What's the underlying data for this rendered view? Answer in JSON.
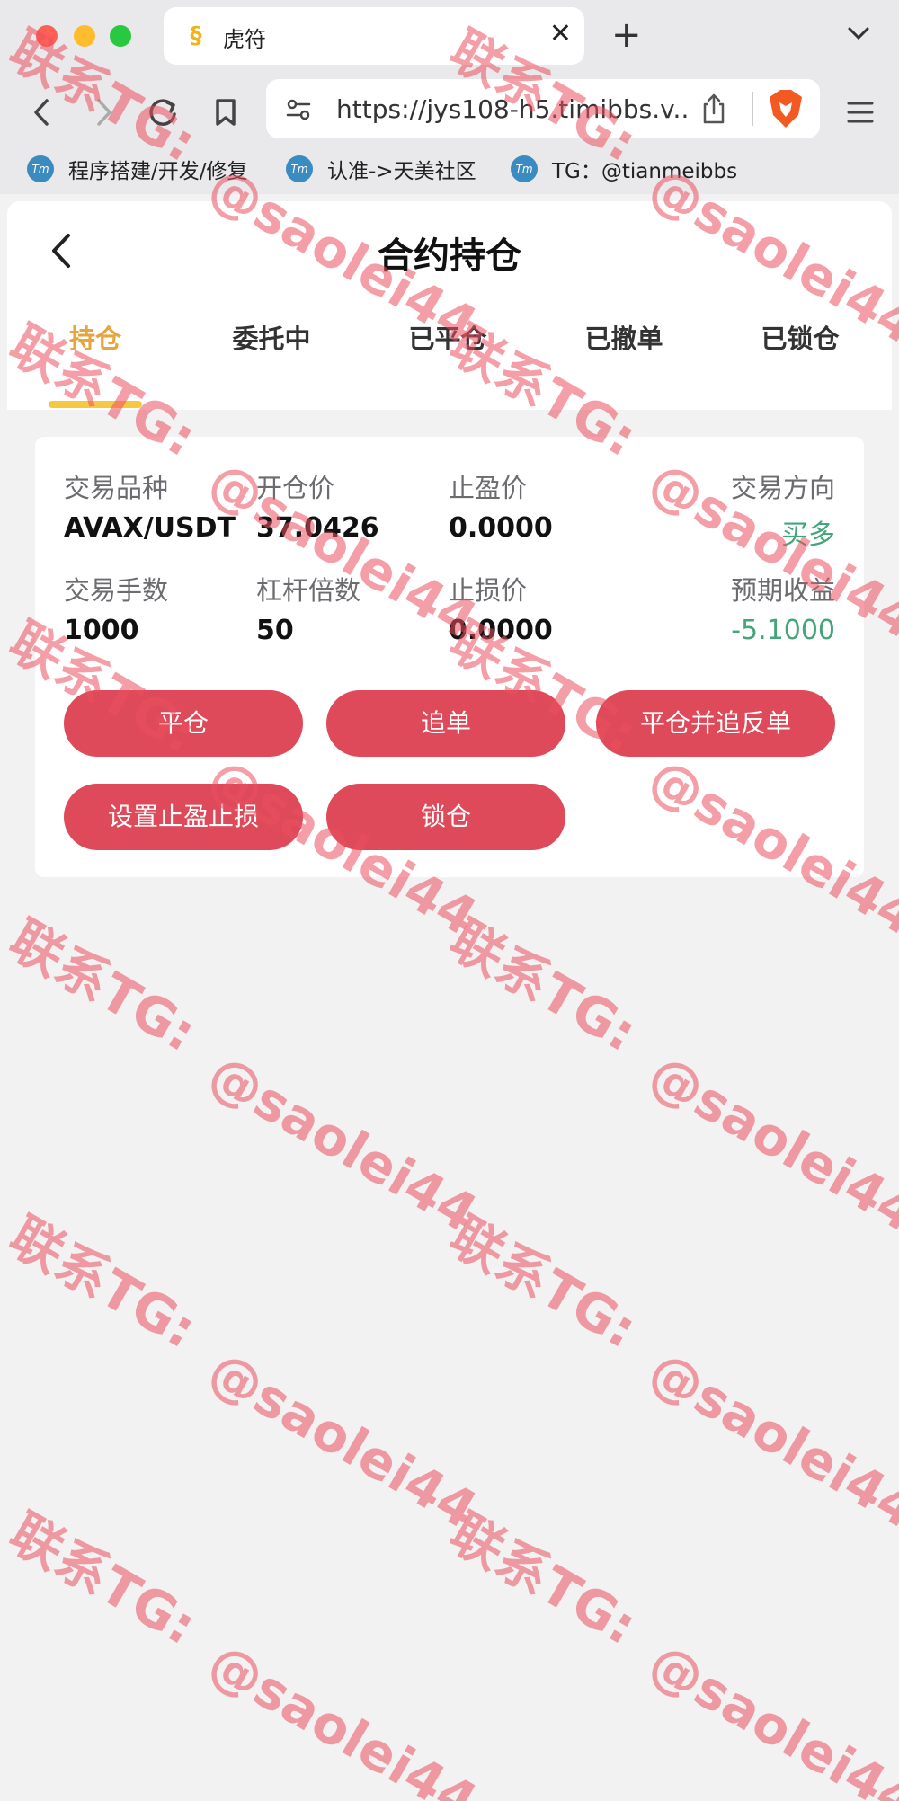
{
  "browser": {
    "tab_title": "虎符",
    "tab_close": "✕",
    "new_tab": "+",
    "url": "https://jys108-h5.timibbs.v...",
    "bookmarks": [
      {
        "icon": "Tm",
        "label": "程序搭建/开发/修复"
      },
      {
        "icon": "Tm",
        "label": "认准->天美社区"
      },
      {
        "icon": "Tm",
        "label": "TG：@tianmeibbs"
      }
    ]
  },
  "page": {
    "title": "合约持仓",
    "tabs": [
      "持仓",
      "委托中",
      "已平仓",
      "已撤单",
      "已锁仓"
    ],
    "active_tab": "持仓"
  },
  "position": {
    "fields": [
      {
        "label": "交易品种",
        "value": "AVAX/USDT"
      },
      {
        "label": "开仓价",
        "value": "37.0426"
      },
      {
        "label": "止盈价",
        "value": "0.0000"
      },
      {
        "label": "交易方向",
        "value": "买多"
      },
      {
        "label": "交易手数",
        "value": "1000"
      },
      {
        "label": "杠杆倍数",
        "value": "50"
      },
      {
        "label": "止损价",
        "value": "0.0000"
      },
      {
        "label": "预期收益",
        "value": "-5.1000"
      }
    ],
    "buttons": [
      "平仓",
      "追单",
      "平仓并追反单",
      "设置止盈止损",
      "锁仓"
    ]
  },
  "watermark": {
    "line1": "联系TG:",
    "line2": "@saolei44"
  },
  "colors": {
    "accent": "#e6a63c",
    "indicator": "#f5c842",
    "button": "#de4a5a",
    "positive": "#43a57a"
  }
}
